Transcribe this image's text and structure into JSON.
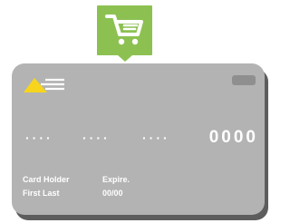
{
  "colors": {
    "cart_badge": "#8cc152",
    "card_face": "#b3b3b3",
    "card_shadow": "#5d5d5d",
    "logo_yellow": "#f7d51d",
    "text": "#ffffff"
  },
  "cart": {
    "icon": "shopping-cart-icon"
  },
  "card": {
    "logo_icon": "card-brand-logo",
    "chip_icon": "card-chip",
    "number_groups": [
      "····",
      "····",
      "····",
      "0000"
    ],
    "holder_label": "Card Holder",
    "holder_value": "First Last",
    "expire_label": "Expire.",
    "expire_value": "00/00"
  }
}
